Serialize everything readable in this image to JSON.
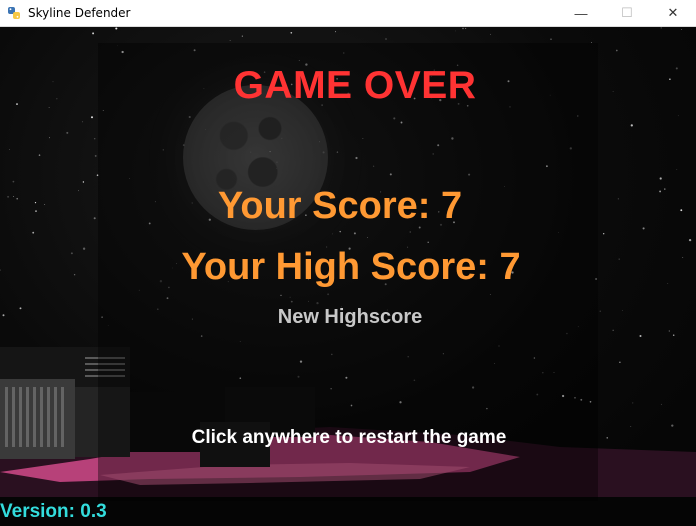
{
  "window": {
    "title": "Skyline Defender",
    "controls": {
      "minimize": "—",
      "maximize": "☐",
      "close": "✕"
    },
    "icon": "python-icon"
  },
  "game": {
    "game_over": "GAME OVER",
    "score_text": "Your Score: 7",
    "high_score_text": "Your High Score: 7",
    "new_highscore": "New Highscore",
    "restart_prompt": "Click anywhere to restart the game",
    "version": "Version: 0.3"
  },
  "colors": {
    "game_over": "#ff3333",
    "score": "#ff9933",
    "new_highscore": "#c8c8c8",
    "restart": "#ffffff",
    "version": "#33dddd"
  }
}
